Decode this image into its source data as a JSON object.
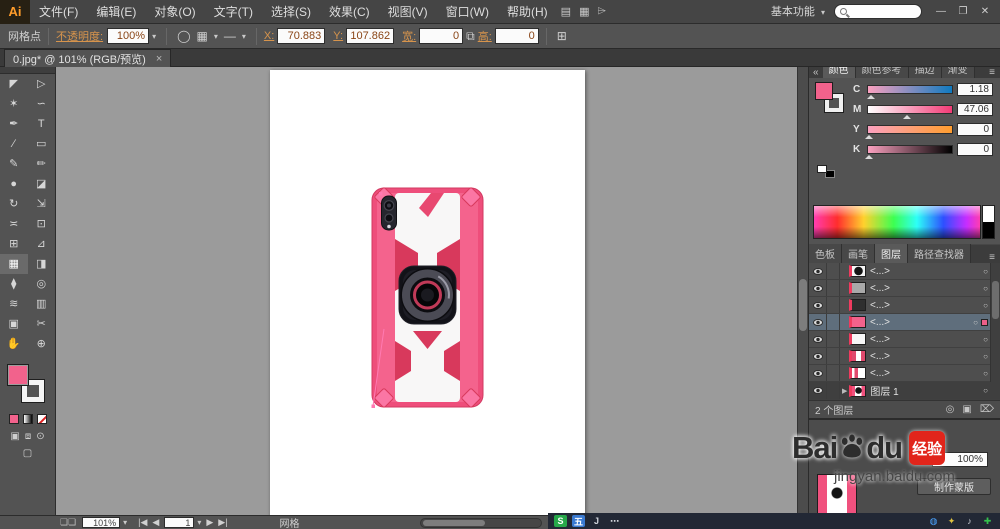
{
  "menubar": {
    "logo": "Ai",
    "items": [
      "文件(F)",
      "编辑(E)",
      "对象(O)",
      "文字(T)",
      "选择(S)",
      "效果(C)",
      "视图(V)",
      "窗口(W)",
      "帮助(H)"
    ],
    "doc_setup_icon": "▤",
    "arrange_icon": "▦",
    "share_icon": "⌲",
    "workspace": "基本功能",
    "workspace_caret": "▾",
    "minimize": "—",
    "restore": "❐",
    "close": "✕"
  },
  "controlbar": {
    "context": "网格点",
    "opacity_label": "不透明度:",
    "opacity_value": "100%",
    "shape_icon": "◯",
    "style_icon": "▦",
    "stroke_icon": "—",
    "x_label": "X:",
    "x_value": "70.883",
    "y_label": "Y:",
    "y_value": "107.862",
    "w_label": "宽:",
    "w_value": "0",
    "link_icon": "⧉",
    "h_label": "高:",
    "h_value": "0",
    "transform_icon": "⊞"
  },
  "tabbar": {
    "title": "0.jpg* @ 101% (RGB/预览)",
    "close": "×"
  },
  "tools": [
    {
      "name": "selection",
      "glyph": "◤"
    },
    {
      "name": "direct-selection",
      "glyph": "▷"
    },
    {
      "name": "magic-wand",
      "glyph": "✶"
    },
    {
      "name": "lasso",
      "glyph": "∽"
    },
    {
      "name": "pen",
      "glyph": "✒"
    },
    {
      "name": "type",
      "glyph": "T"
    },
    {
      "name": "line-segment",
      "glyph": "∕"
    },
    {
      "name": "rectangle",
      "glyph": "▭"
    },
    {
      "name": "paintbrush",
      "glyph": "✎"
    },
    {
      "name": "pencil",
      "glyph": "✏"
    },
    {
      "name": "blob-brush",
      "glyph": "●"
    },
    {
      "name": "eraser",
      "glyph": "◪"
    },
    {
      "name": "rotate",
      "glyph": "↻"
    },
    {
      "name": "scale",
      "glyph": "⇲"
    },
    {
      "name": "width",
      "glyph": "≍"
    },
    {
      "name": "free-transform",
      "glyph": "⊡"
    },
    {
      "name": "shape-builder",
      "glyph": "⊞"
    },
    {
      "name": "perspective-grid",
      "glyph": "⊿"
    },
    {
      "name": "mesh",
      "glyph": "▦"
    },
    {
      "name": "gradient",
      "glyph": "◨"
    },
    {
      "name": "eyedropper",
      "glyph": "⧫"
    },
    {
      "name": "blend",
      "glyph": "◎"
    },
    {
      "name": "symbol-sprayer",
      "glyph": "≋"
    },
    {
      "name": "column-graph",
      "glyph": "▥"
    },
    {
      "name": "artboard",
      "glyph": "▣"
    },
    {
      "name": "slice",
      "glyph": "✂"
    },
    {
      "name": "hand",
      "glyph": "✋"
    },
    {
      "name": "zoom",
      "glyph": "⊕"
    }
  ],
  "toolbar_bottom": {
    "color_mode": "■",
    "gradient_mode": "◨",
    "none_mode": "∅",
    "draw_normal": "▣",
    "draw_behind": "⧈",
    "draw_inside": "⊙",
    "screen_mode": "▢"
  },
  "color_panel": {
    "collapse": "«",
    "tabs": [
      "颜色",
      "颜色参考",
      "描边",
      "渐变"
    ],
    "menu": "≡",
    "channels": [
      {
        "label": "C",
        "value": "1.18"
      },
      {
        "label": "M",
        "value": "47.06"
      },
      {
        "label": "Y",
        "value": "0"
      },
      {
        "label": "K",
        "value": "0"
      }
    ]
  },
  "layers_panel": {
    "tabs": [
      "色板",
      "画笔",
      "图层",
      "路径查找器"
    ],
    "menu": "≡",
    "rows": [
      {
        "label": "<...>"
      },
      {
        "label": "<...>"
      },
      {
        "label": "<...>"
      },
      {
        "label": "<...>"
      },
      {
        "label": "<...>"
      },
      {
        "label": "<...>"
      },
      {
        "label": "<...>"
      }
    ],
    "target": "○",
    "parent_label": "图层 1",
    "parent_disclosure": "▶",
    "status": "2 个图层",
    "clip_icon": "◎",
    "new_layer_icon": "▣",
    "delete_icon": "⌦"
  },
  "transparency_panel": {
    "opacity_value": "100%",
    "make_mask_label": "制作蒙版"
  },
  "statusbar": {
    "pages_icon": "❏❏",
    "zoom": "101%",
    "nav_first": "|◀",
    "nav_prev": "◀",
    "frame": "1",
    "nav_next": "▶",
    "nav_last": "▶|",
    "tool_label": "网格"
  },
  "watermark": {
    "bai": "Bai",
    "du": "du",
    "badge": "经验",
    "url": "jingyan.baidu.com"
  },
  "tray": {
    "ime_s": "S",
    "ime_wu": "五",
    "ime_j": "J",
    "ime_more": "⋯",
    "icon_chat": "◍",
    "icon_star": "✦",
    "icon_sound": "♪",
    "icon_shield": "✚"
  }
}
